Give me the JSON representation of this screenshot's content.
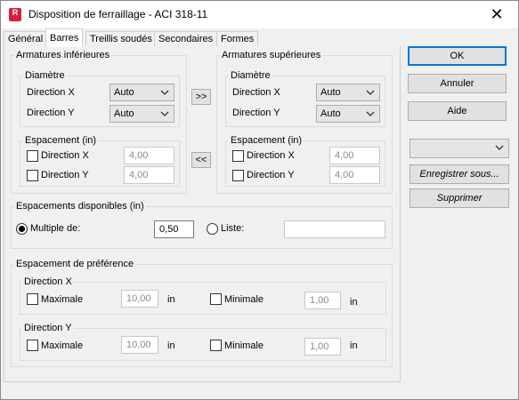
{
  "window": {
    "title": "Disposition de ferraillage - ACI 318-11",
    "close_glyph": "✕",
    "app_icon_letter": "R"
  },
  "tabs": [
    {
      "label": "Général"
    },
    {
      "label": "Barres"
    },
    {
      "label": "Treillis soudés"
    },
    {
      "label": "Secondaires"
    },
    {
      "label": "Formes"
    }
  ],
  "bottom_bars": {
    "title": "Armatures inférieures",
    "diameter": {
      "title": "Diamètre",
      "x_label": "Direction X",
      "y_label": "Direction Y",
      "x_value": "Auto",
      "y_value": "Auto"
    },
    "spacing": {
      "title": "Espacement (in)",
      "x_label": "Direction X",
      "y_label": "Direction Y",
      "x_value": "4,00",
      "y_value": "4,00"
    }
  },
  "top_bars": {
    "title": "Armatures supérieures",
    "diameter": {
      "title": "Diamètre",
      "x_label": "Direction X",
      "y_label": "Direction Y",
      "x_value": "Auto",
      "y_value": "Auto"
    },
    "spacing": {
      "title": "Espacement (in)",
      "x_label": "Direction X",
      "y_label": "Direction Y",
      "x_value": "4,00",
      "y_value": "4,00"
    }
  },
  "copy_buttons": {
    "to_top": ">>",
    "to_bottom": "<<"
  },
  "available_spacing": {
    "title": "Espacements disponibles (in)",
    "multiple_label": "Multiple de:",
    "multiple_value": "0,50",
    "list_label": "Liste:",
    "list_value": "",
    "selected": "multiple"
  },
  "preferred_spacing": {
    "title": "Espacement de préférence",
    "dir_x": {
      "title": "Direction X",
      "max_label": "Maximale",
      "max_value": "10,00",
      "max_unit": "in",
      "min_label": "Minimale",
      "min_value": "1,00",
      "min_unit": "in"
    },
    "dir_y": {
      "title": "Direction Y",
      "max_label": "Maximale",
      "max_value": "10,00",
      "max_unit": "in",
      "min_label": "Minimale",
      "min_value": "1,00",
      "min_unit": "in"
    }
  },
  "buttons": {
    "ok": "OK",
    "cancel": "Annuler",
    "help": "Aide",
    "preset_value": "",
    "save_as": "Enregistrer sous...",
    "delete": "Supprimer"
  },
  "icons": {
    "dropdown": "chevron-down-icon",
    "close": "close-icon",
    "app": "revit-icon"
  },
  "colors": {
    "app_icon": "#d81e3a",
    "default_button_border": "#0078d7",
    "background": "#f0f0f0"
  }
}
